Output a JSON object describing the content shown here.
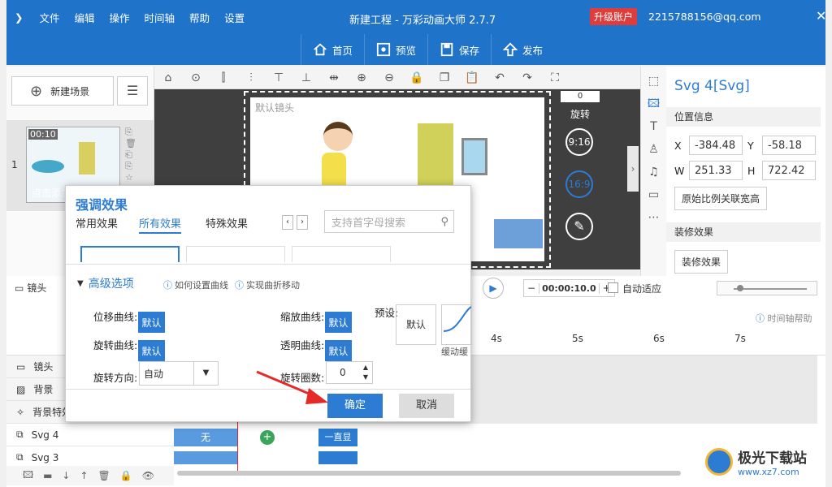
{
  "titlebar": {
    "menu": [
      "文件",
      "编辑",
      "操作",
      "时间轴",
      "帮助",
      "设置"
    ],
    "title": "新建工程 - 万彩动画大师 2.7.7",
    "upgrade": "升级账户",
    "account": "2215788156@qq.com"
  },
  "toolbar": {
    "home": "首页",
    "preview": "预览",
    "save": "保存",
    "publish": "发布"
  },
  "left": {
    "new_scene": "新建场景",
    "scene_number": "1",
    "scene_time": "00:10",
    "scene_caption": "点击添加"
  },
  "canvas": {
    "camera_label": "默认镜头",
    "rotate_value": "0",
    "rotate_label": "旋转",
    "ratio_916": "9:16",
    "ratio_169": "16:9"
  },
  "right": {
    "title": "Svg 4[Svg]",
    "position_header": "位置信息",
    "x_label": "X",
    "x_value": "-384.48",
    "y_label": "Y",
    "y_value": "-58.18",
    "w_label": "W",
    "w_value": "251.33",
    "h_label": "H",
    "h_value": "722.42",
    "ratio_button": "原始比例关联宽高",
    "decor_header": "装修效果",
    "decor_button": "装修效果"
  },
  "timeline": {
    "camera_tab": "镜头",
    "time_value": "00:00:10.0",
    "auto_fit": "自动适应",
    "help": "时间轴帮助",
    "ticks": [
      "4s",
      "5s",
      "6s",
      "7s"
    ],
    "tracks": [
      "镜头",
      "背景",
      "背景特效",
      "Svg 4",
      "Svg 3"
    ],
    "cell_none": "无",
    "cell_always": "一直显"
  },
  "dialog": {
    "title": "强调效果",
    "tabs": [
      "常用效果",
      "所有效果",
      "特殊效果"
    ],
    "search_placeholder": "支持首字母搜索",
    "advanced": "高级选项",
    "help_curve": "如何设置曲线",
    "help_move": "实现曲折移动",
    "move_curve": "位移曲线:",
    "rotate_curve": "旋转曲线:",
    "rotate_dir": "旋转方向:",
    "rotate_dir_value": "自动",
    "scale_curve": "缩放曲线:",
    "alpha_curve": "透明曲线:",
    "rotate_turns": "旋转圈数:",
    "rotate_turns_value": "0",
    "default": "默认",
    "preset": "预设:",
    "preset_default": "默认",
    "ease_label": "缓动缓",
    "confirm": "确定",
    "cancel": "取消"
  },
  "watermark": {
    "text": "极光下载站",
    "url": "www.xz7.com"
  }
}
